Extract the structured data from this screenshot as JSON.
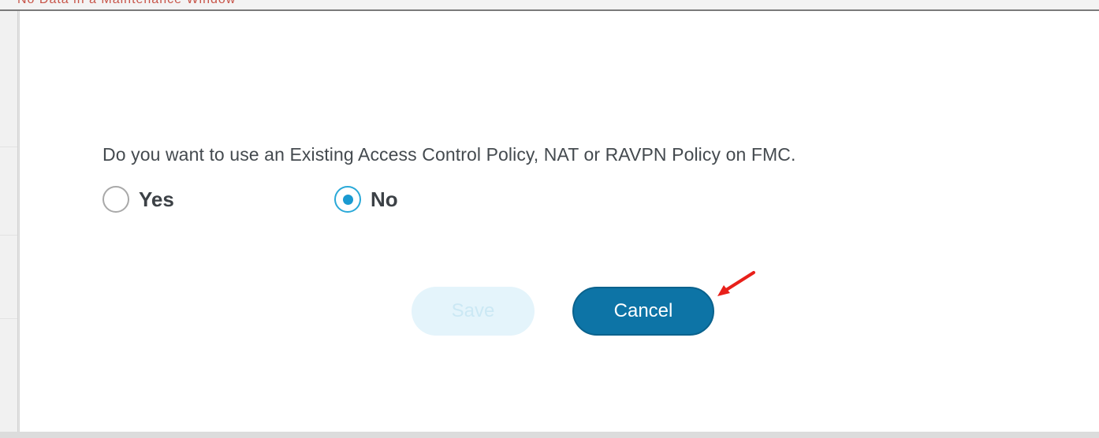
{
  "background_header_text": "No Data in a Maintenance Window",
  "dialog": {
    "question": "Do you want to use an Existing Access Control Policy, NAT or RAVPN Policy on FMC.",
    "options": [
      {
        "label": "Yes",
        "selected": false
      },
      {
        "label": "No",
        "selected": true
      }
    ],
    "save_label": "Save",
    "save_enabled": false,
    "cancel_label": "Cancel"
  },
  "colors": {
    "accent": "#0d74a6",
    "radio_selected": "#1a9ad1",
    "disabled_button_bg": "#e4f4fb",
    "annotation_arrow": "#e8201a"
  },
  "icons": [
    "radio-unchecked-icon",
    "radio-checked-icon",
    "annotation-arrow-icon"
  ]
}
